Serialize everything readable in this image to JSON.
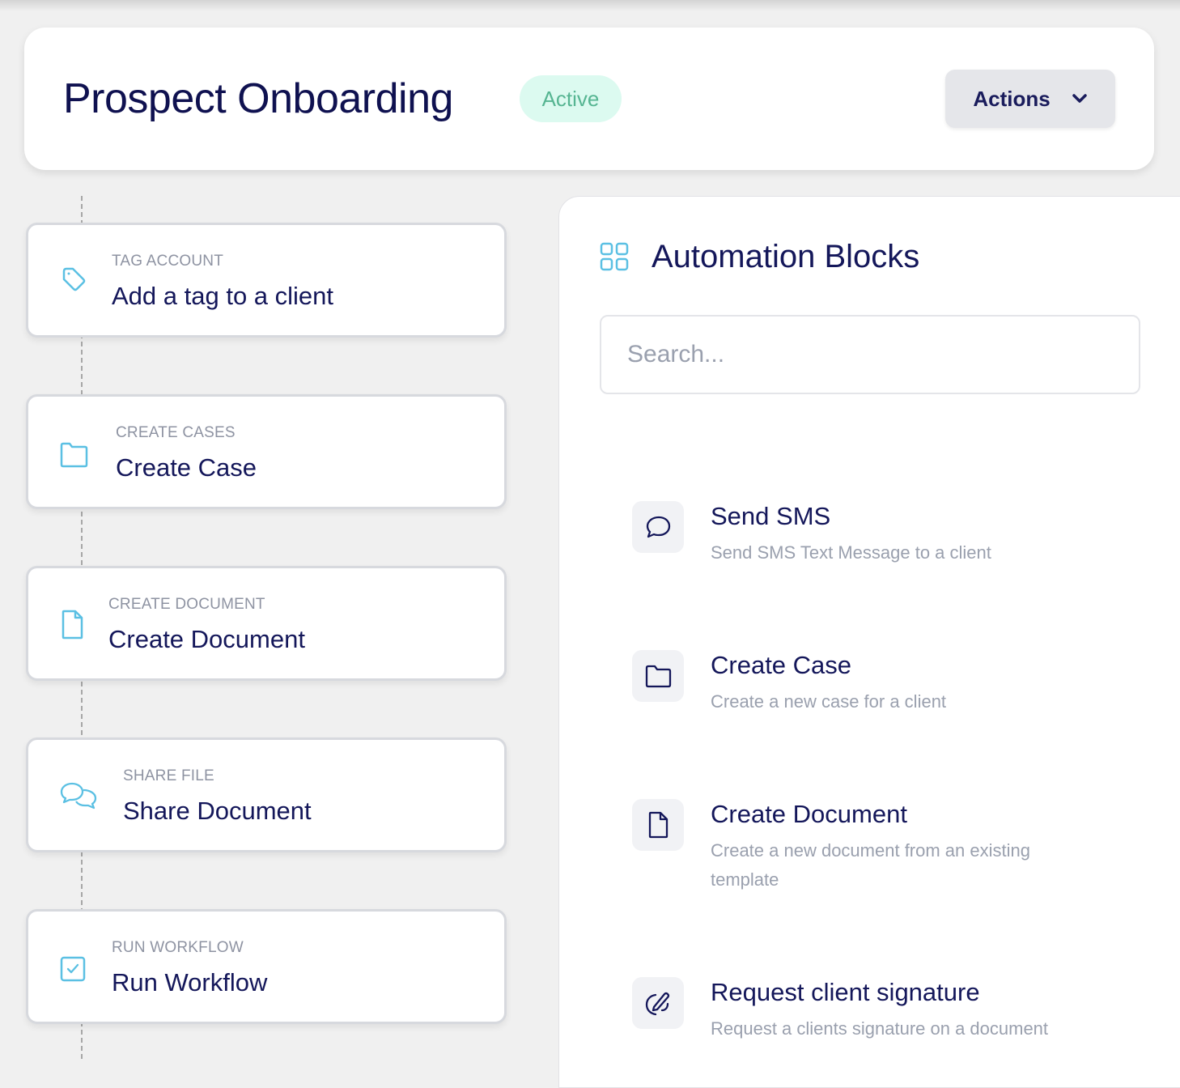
{
  "header": {
    "title": "Prospect Onboarding",
    "status": "Active",
    "actions_label": "Actions"
  },
  "colors": {
    "primary_text": "#0f1150",
    "accent_icon": "#5bc0e3",
    "status_bg": "#dcfaf0",
    "status_text": "#56b592",
    "muted_text": "#9aa0ae"
  },
  "workflow_steps": [
    {
      "icon": "tag-icon",
      "category": "TAG ACCOUNT",
      "title": "Add a tag to a client"
    },
    {
      "icon": "folder-icon",
      "category": "CREATE CASES",
      "title": "Create Case"
    },
    {
      "icon": "document-icon",
      "category": "CREATE DOCUMENT",
      "title": "Create Document"
    },
    {
      "icon": "chat-bubbles-icon",
      "category": "SHARE FILE",
      "title": "Share Document"
    },
    {
      "icon": "checkbox-icon",
      "category": "RUN WORKFLOW",
      "title": "Run Workflow"
    }
  ],
  "automation_panel": {
    "icon": "grid-icon",
    "title": "Automation Blocks",
    "search_placeholder": "Search...",
    "search_value": "",
    "blocks": [
      {
        "icon": "chat-bubble-icon",
        "title": "Send SMS",
        "description": "Send SMS Text Message to a client"
      },
      {
        "icon": "folder-icon",
        "title": "Create Case",
        "description": "Create a new case for a client"
      },
      {
        "icon": "document-icon",
        "title": "Create Document",
        "description": "Create a new document from an existing template"
      },
      {
        "icon": "signature-pen-icon",
        "title": "Request client signature",
        "description": "Request a clients signature on a document"
      }
    ]
  }
}
